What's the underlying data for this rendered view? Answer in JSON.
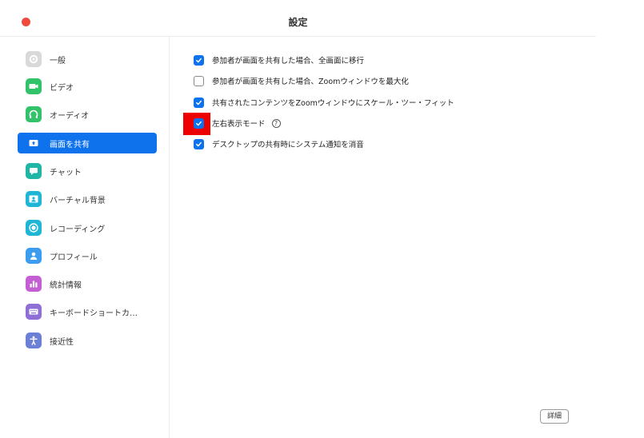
{
  "window": {
    "title": "設定"
  },
  "sidebar": {
    "items": [
      {
        "label": "一般",
        "icon": "gear-icon",
        "color": "#d9d9d9",
        "active": false
      },
      {
        "label": "ビデオ",
        "icon": "video-icon",
        "color": "#32c26a",
        "active": false
      },
      {
        "label": "オーディオ",
        "icon": "headphones-icon",
        "color": "#32c26a",
        "active": false
      },
      {
        "label": "画面を共有",
        "icon": "share-screen-icon",
        "color": "#ffffff",
        "active": true
      },
      {
        "label": "チャット",
        "icon": "chat-icon",
        "color": "#1fb6a6",
        "active": false
      },
      {
        "label": "バーチャル背景",
        "icon": "virtual-background-icon",
        "color": "#1fb6d6",
        "active": false
      },
      {
        "label": "レコーディング",
        "icon": "recording-icon",
        "color": "#1fb6d6",
        "active": false
      },
      {
        "label": "プロフィール",
        "icon": "profile-icon",
        "color": "#3b9cf0",
        "active": false
      },
      {
        "label": "統計情報",
        "icon": "statistics-icon",
        "color": "#c45fd3",
        "active": false
      },
      {
        "label": "キーボードショートカ…",
        "icon": "keyboard-icon",
        "color": "#8e6fd6",
        "active": false
      },
      {
        "label": "接近性",
        "icon": "accessibility-icon",
        "color": "#6b7fd6",
        "active": false
      }
    ]
  },
  "options": [
    {
      "label": "参加者が画面を共有した場合、全画面に移行",
      "checked": true
    },
    {
      "label": "参加者が画面を共有した場合、Zoomウィンドウを最大化",
      "checked": false
    },
    {
      "label": "共有されたコンテンツをZoomウィンドウにスケール・ツー・フィット",
      "checked": true
    },
    {
      "label": "左右表示モード",
      "checked": true,
      "help": "?"
    },
    {
      "label": "デスクトップの共有時にシステム通知を消音",
      "checked": true
    }
  ],
  "buttons": {
    "detail": "詳細"
  },
  "colors": {
    "accent": "#0e72ed",
    "close": "#ee4b3e",
    "highlight": "#ee0000"
  }
}
